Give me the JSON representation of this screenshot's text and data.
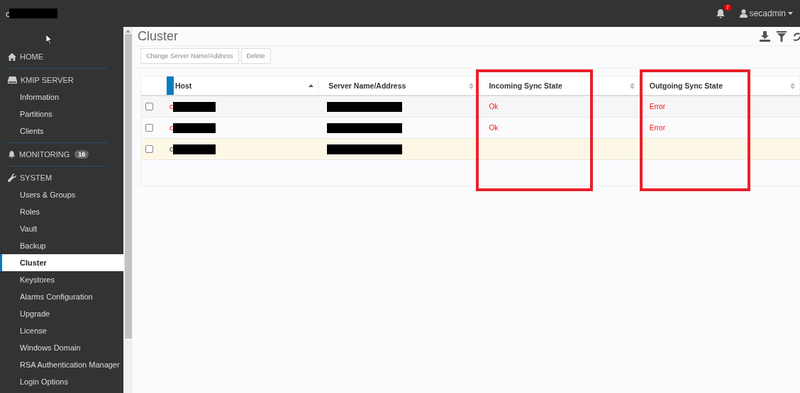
{
  "topbar": {
    "brand": "c",
    "notifications": "7",
    "user": "secadmin"
  },
  "sidebar": {
    "sections": [
      {
        "label": "HOME"
      },
      {
        "label": "KMIP SERVER",
        "children": [
          {
            "label": "Information",
            "selected": false
          },
          {
            "label": "Partitions",
            "selected": false
          },
          {
            "label": "Clients",
            "selected": false
          }
        ]
      },
      {
        "label": "MONITORING",
        "badge": "16"
      },
      {
        "label": "SYSTEM",
        "children": [
          {
            "label": "Users & Groups",
            "selected": false
          },
          {
            "label": "Roles",
            "selected": false
          },
          {
            "label": "Vault",
            "selected": false
          },
          {
            "label": "Backup",
            "selected": false
          },
          {
            "label": "Cluster",
            "selected": true
          },
          {
            "label": "Keystores",
            "selected": false
          },
          {
            "label": "Alarms Configuration",
            "selected": false
          },
          {
            "label": "Upgrade",
            "selected": false
          },
          {
            "label": "License",
            "selected": false
          },
          {
            "label": "Windows Domain",
            "selected": false
          },
          {
            "label": "RSA Authentication Manager",
            "selected": false
          },
          {
            "label": "Login Options",
            "selected": false
          }
        ]
      }
    ]
  },
  "page": {
    "title": "Cluster",
    "buttons": [
      "Change Server Name/Address",
      "Delete"
    ]
  },
  "table": {
    "columns": [
      {
        "label": "Host",
        "sorted": true,
        "annotated": false
      },
      {
        "label": "Server Name/Address",
        "sorted": false,
        "annotated": false
      },
      {
        "label": "Incoming Sync State",
        "sorted": false,
        "annotated": true
      },
      {
        "label": "Outgoing Sync State",
        "sorted": false,
        "annotated": true
      }
    ],
    "rows": [
      {
        "checked": false,
        "highlighted": false,
        "host": "c",
        "host_error": true,
        "incoming": "Ok",
        "outgoing": "Error"
      },
      {
        "checked": false,
        "highlighted": false,
        "host": "c",
        "host_error": true,
        "incoming": "Ok",
        "outgoing": "Error"
      },
      {
        "checked": false,
        "highlighted": true,
        "host": "c",
        "host_error": false
      }
    ]
  }
}
